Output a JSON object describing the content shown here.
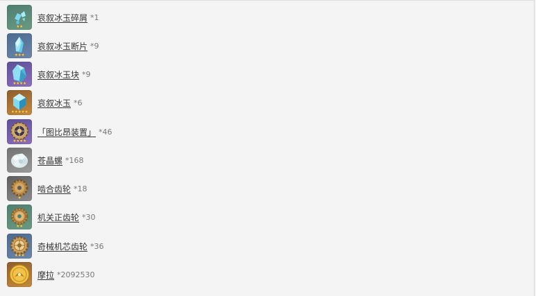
{
  "items": [
    {
      "name": "哀叙冰玉碎屑",
      "count": "*1",
      "stars": "★★",
      "icon": "ice-shard-icon"
    },
    {
      "name": "哀叙冰玉断片",
      "count": "*9",
      "stars": "★★★",
      "icon": "ice-fragment-icon"
    },
    {
      "name": "哀叙冰玉块",
      "count": "*9",
      "stars": "★★★★",
      "icon": "ice-chunk-icon"
    },
    {
      "name": "哀叙冰玉",
      "count": "*6",
      "stars": "★★★★★",
      "icon": "ice-gemstone-icon"
    },
    {
      "name": "「图比昂装置」",
      "count": "*46",
      "stars": "★★★★",
      "icon": "tourbillon-device-icon"
    },
    {
      "name": "苍晶螺",
      "count": "*168",
      "stars": "",
      "icon": "crystal-snail-icon"
    },
    {
      "name": "啮合齿轮",
      "count": "*18",
      "stars": "★",
      "icon": "gear-icon"
    },
    {
      "name": "机关正齿轮",
      "count": "*30",
      "stars": "★★",
      "icon": "spur-gear-icon"
    },
    {
      "name": "奇械机芯齿轮",
      "count": "*36",
      "stars": "★★★",
      "icon": "mechanism-gear-icon"
    },
    {
      "name": "摩拉",
      "count": "*2092530",
      "stars": "",
      "icon": "mora-coin-icon"
    }
  ]
}
